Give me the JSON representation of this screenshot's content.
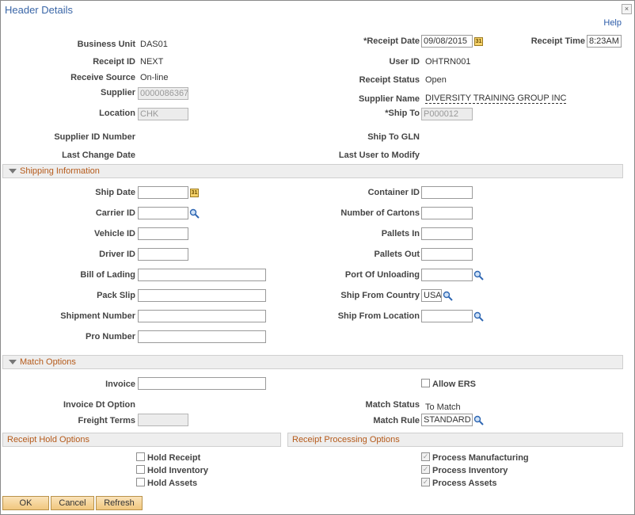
{
  "window": {
    "title": "Header Details",
    "close_glyph": "×",
    "help": "Help"
  },
  "header": {
    "business_unit_label": "Business Unit",
    "business_unit": "DAS01",
    "receipt_date_label": "*Receipt Date",
    "receipt_date": "09/08/2015",
    "receipt_time_label": "Receipt Time",
    "receipt_time": "8:23AM",
    "receipt_id_label": "Receipt ID",
    "receipt_id": "NEXT",
    "user_id_label": "User ID",
    "user_id": "OHTRN001",
    "receive_source_label": "Receive Source",
    "receive_source": "On-line",
    "receipt_status_label": "Receipt Status",
    "receipt_status": "Open",
    "supplier_label": "Supplier",
    "supplier": "0000086367",
    "supplier_name_label": "Supplier Name",
    "supplier_name": "DIVERSITY TRAINING GROUP INC",
    "location_label": "Location",
    "location": "CHK",
    "ship_to_label": "*Ship To",
    "ship_to": "P000012",
    "supplier_id_number_label": "Supplier ID Number",
    "ship_to_gln_label": "Ship To GLN",
    "last_change_date_label": "Last Change Date",
    "last_user_label": "Last User to Modify"
  },
  "shipping": {
    "title": "Shipping Information",
    "ship_date_label": "Ship Date",
    "ship_date": "",
    "container_id_label": "Container ID",
    "container_id": "",
    "carrier_id_label": "Carrier ID",
    "carrier_id": "",
    "number_of_cartons_label": "Number of Cartons",
    "number_of_cartons": "",
    "vehicle_id_label": "Vehicle ID",
    "vehicle_id": "",
    "pallets_in_label": "Pallets In",
    "pallets_in": "",
    "driver_id_label": "Driver ID",
    "driver_id": "",
    "pallets_out_label": "Pallets Out",
    "pallets_out": "",
    "bill_of_lading_label": "Bill of Lading",
    "bill_of_lading": "",
    "port_of_unloading_label": "Port Of Unloading",
    "port_of_unloading": "",
    "pack_slip_label": "Pack Slip",
    "pack_slip": "",
    "ship_from_country_label": "Ship From Country",
    "ship_from_country": "USA",
    "shipment_number_label": "Shipment Number",
    "shipment_number": "",
    "ship_from_location_label": "Ship From Location",
    "ship_from_location": "",
    "pro_number_label": "Pro Number",
    "pro_number": ""
  },
  "match": {
    "title": "Match Options",
    "invoice_label": "Invoice",
    "invoice": "",
    "allow_ers_label": "Allow ERS",
    "invoice_dt_option_label": "Invoice Dt Option",
    "match_status_label": "Match Status",
    "match_status": "To Match",
    "freight_terms_label": "Freight Terms",
    "freight_terms": "",
    "match_rule_label": "Match Rule",
    "match_rule": "STANDARD"
  },
  "hold": {
    "title": "Receipt Hold Options",
    "hold_receipt": "Hold Receipt",
    "hold_inventory": "Hold Inventory",
    "hold_assets": "Hold Assets"
  },
  "processing": {
    "title": "Receipt Processing Options",
    "process_manufacturing": "Process Manufacturing",
    "process_inventory": "Process Inventory",
    "process_assets": "Process Assets",
    "check_glyph": "✓"
  },
  "buttons": {
    "ok": "OK",
    "cancel": "Cancel",
    "refresh": "Refresh"
  },
  "icons": {
    "calendar": "31"
  },
  "colors": {
    "title": "#3a66a7",
    "section_label": "#b55a1a",
    "button": "#f0c77e"
  }
}
